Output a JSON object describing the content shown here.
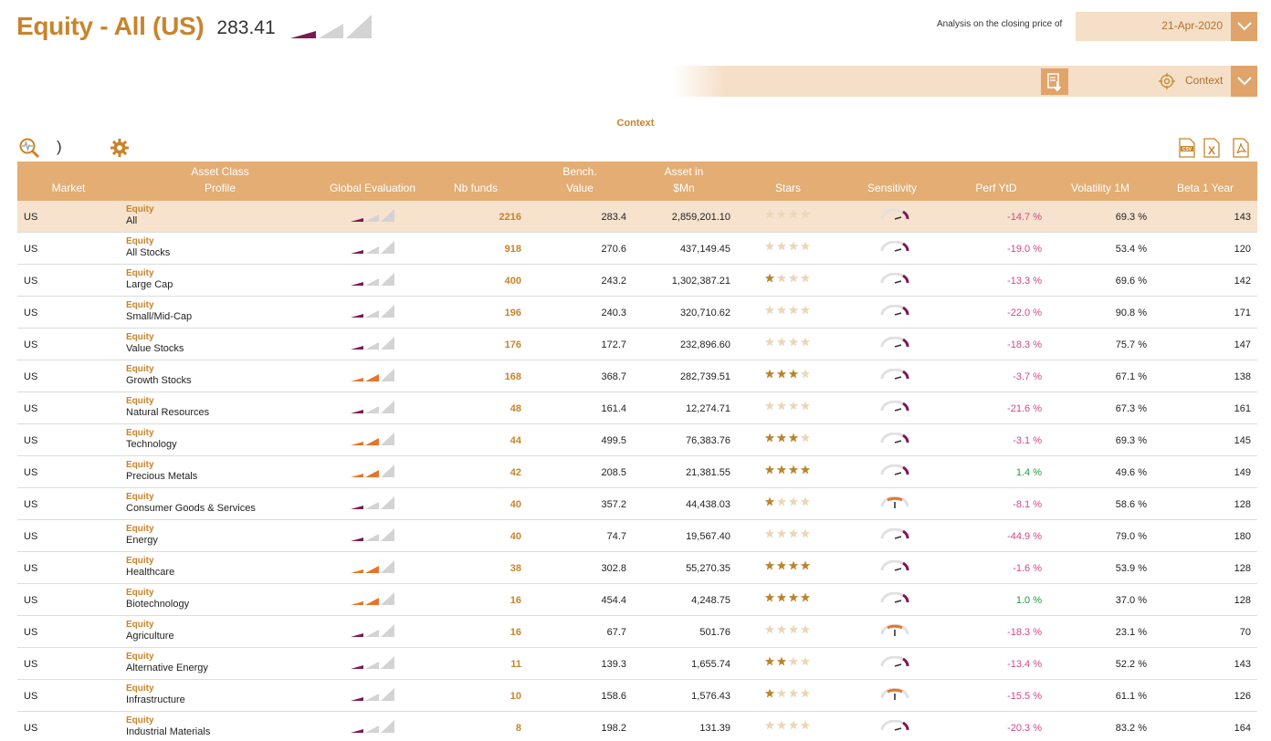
{
  "header": {
    "title": "Equity - All (US)",
    "value": "283.41",
    "evaluation": "purple-1",
    "analysis_label": "Analysis on the closing price of",
    "date": "21-Apr-2020",
    "context_label": "Context",
    "context_link": "Context"
  },
  "toolbar": {
    "paren": ")",
    "icons": [
      "search-chart-icon",
      "gear-icon",
      "csv-icon",
      "excel-icon",
      "pdf-icon"
    ]
  },
  "colors": {
    "accent": "#c8842a",
    "header_bg": "#e3ad74",
    "highlight_row": "#f6e2cd",
    "negative": "#d0488a",
    "positive": "#239a3b",
    "eval_purple": "#7b1a52",
    "eval_orange": "#e8742b"
  },
  "columns": {
    "market": "Market",
    "asset_class": "Asset Class\nProfile",
    "global_eval": "Global Evaluation",
    "nb_funds": "Nb funds",
    "bench": "Bench.\nValue",
    "asset": "Asset in\n$Mn",
    "stars": "Stars",
    "sensitivity": "Sensitivity",
    "perf": "Perf YtD",
    "vol": "Volatility 1M",
    "beta": "Beta 1 Year"
  },
  "rows": [
    {
      "market": "US",
      "cat": "Equity",
      "sub": "All",
      "eval": "purple-1",
      "nb": "2216",
      "bench": "283.4",
      "asset": "2,859,201.10",
      "stars": 0,
      "sens": "low",
      "perf": "-14.7 %",
      "vol": "69.3 %",
      "beta": "143",
      "highlight": true
    },
    {
      "market": "US",
      "cat": "Equity",
      "sub": "All Stocks",
      "eval": "purple-1",
      "nb": "918",
      "bench": "270.6",
      "asset": "437,149.45",
      "stars": 0,
      "sens": "low",
      "perf": "-19.0 %",
      "vol": "53.4 %",
      "beta": "120"
    },
    {
      "market": "US",
      "cat": "Equity",
      "sub": "Large Cap",
      "eval": "purple-1",
      "nb": "400",
      "bench": "243.2",
      "asset": "1,302,387.21",
      "stars": 1,
      "sens": "low",
      "perf": "-13.3 %",
      "vol": "69.6 %",
      "beta": "142"
    },
    {
      "market": "US",
      "cat": "Equity",
      "sub": "Small/Mid-Cap",
      "eval": "purple-1",
      "nb": "196",
      "bench": "240.3",
      "asset": "320,710.62",
      "stars": 0,
      "sens": "low",
      "perf": "-22.0 %",
      "vol": "90.8 %",
      "beta": "171"
    },
    {
      "market": "US",
      "cat": "Equity",
      "sub": "Value Stocks",
      "eval": "purple-1",
      "nb": "176",
      "bench": "172.7",
      "asset": "232,896.60",
      "stars": 0,
      "sens": "low",
      "perf": "-18.3 %",
      "vol": "75.7 %",
      "beta": "147"
    },
    {
      "market": "US",
      "cat": "Equity",
      "sub": "Growth Stocks",
      "eval": "orange-2",
      "nb": "168",
      "bench": "368.7",
      "asset": "282,739.51",
      "stars": 3,
      "sens": "low",
      "perf": "-3.7 %",
      "vol": "67.1 %",
      "beta": "138"
    },
    {
      "market": "US",
      "cat": "Equity",
      "sub": "Natural Resources",
      "eval": "purple-1",
      "nb": "48",
      "bench": "161.4",
      "asset": "12,274.71",
      "stars": 0,
      "sens": "low",
      "perf": "-21.6 %",
      "vol": "67.3 %",
      "beta": "161"
    },
    {
      "market": "US",
      "cat": "Equity",
      "sub": "Technology",
      "eval": "orange-2",
      "nb": "44",
      "bench": "499.5",
      "asset": "76,383.76",
      "stars": 3,
      "sens": "low",
      "perf": "-3.1 %",
      "vol": "69.3 %",
      "beta": "145"
    },
    {
      "market": "US",
      "cat": "Equity",
      "sub": "Precious Metals",
      "eval": "orange-2",
      "nb": "42",
      "bench": "208.5",
      "asset": "21,381.55",
      "stars": 4,
      "sens": "low",
      "perf": "1.4 %",
      "vol": "49.6 %",
      "beta": "149"
    },
    {
      "market": "US",
      "cat": "Equity",
      "sub": "Consumer Goods & Services",
      "eval": "purple-1",
      "nb": "40",
      "bench": "357.2",
      "asset": "44,438.03",
      "stars": 1,
      "sens": "mid",
      "perf": "-8.1 %",
      "vol": "58.6 %",
      "beta": "128"
    },
    {
      "market": "US",
      "cat": "Equity",
      "sub": "Energy",
      "eval": "purple-1",
      "nb": "40",
      "bench": "74.7",
      "asset": "19,567.40",
      "stars": 0,
      "sens": "low",
      "perf": "-44.9 %",
      "vol": "79.0 %",
      "beta": "180"
    },
    {
      "market": "US",
      "cat": "Equity",
      "sub": "Healthcare",
      "eval": "orange-2",
      "nb": "38",
      "bench": "302.8",
      "asset": "55,270.35",
      "stars": 4,
      "sens": "low",
      "perf": "-1.6 %",
      "vol": "53.9 %",
      "beta": "128"
    },
    {
      "market": "US",
      "cat": "Equity",
      "sub": "Biotechnology",
      "eval": "orange-2",
      "nb": "16",
      "bench": "454.4",
      "asset": "4,248.75",
      "stars": 4,
      "sens": "low",
      "perf": "1.0 %",
      "vol": "37.0 %",
      "beta": "128"
    },
    {
      "market": "US",
      "cat": "Equity",
      "sub": "Agriculture",
      "eval": "purple-1",
      "nb": "16",
      "bench": "67.7",
      "asset": "501.76",
      "stars": 0,
      "sens": "mid",
      "perf": "-18.3 %",
      "vol": "23.1 %",
      "beta": "70"
    },
    {
      "market": "US",
      "cat": "Equity",
      "sub": "Alternative Energy",
      "eval": "purple-1",
      "nb": "11",
      "bench": "139.3",
      "asset": "1,655.74",
      "stars": 2,
      "sens": "low",
      "perf": "-13.4 %",
      "vol": "52.2 %",
      "beta": "143"
    },
    {
      "market": "US",
      "cat": "Equity",
      "sub": "Infrastructure",
      "eval": "purple-1",
      "nb": "10",
      "bench": "158.6",
      "asset": "1,576.43",
      "stars": 1,
      "sens": "mid",
      "perf": "-15.5 %",
      "vol": "61.1 %",
      "beta": "126"
    },
    {
      "market": "US",
      "cat": "Equity",
      "sub": "Industrial Materials",
      "eval": "purple-1",
      "nb": "8",
      "bench": "198.2",
      "asset": "131.39",
      "stars": 0,
      "sens": "low",
      "perf": "-20.3 %",
      "vol": "83.2 %",
      "beta": "164"
    }
  ]
}
